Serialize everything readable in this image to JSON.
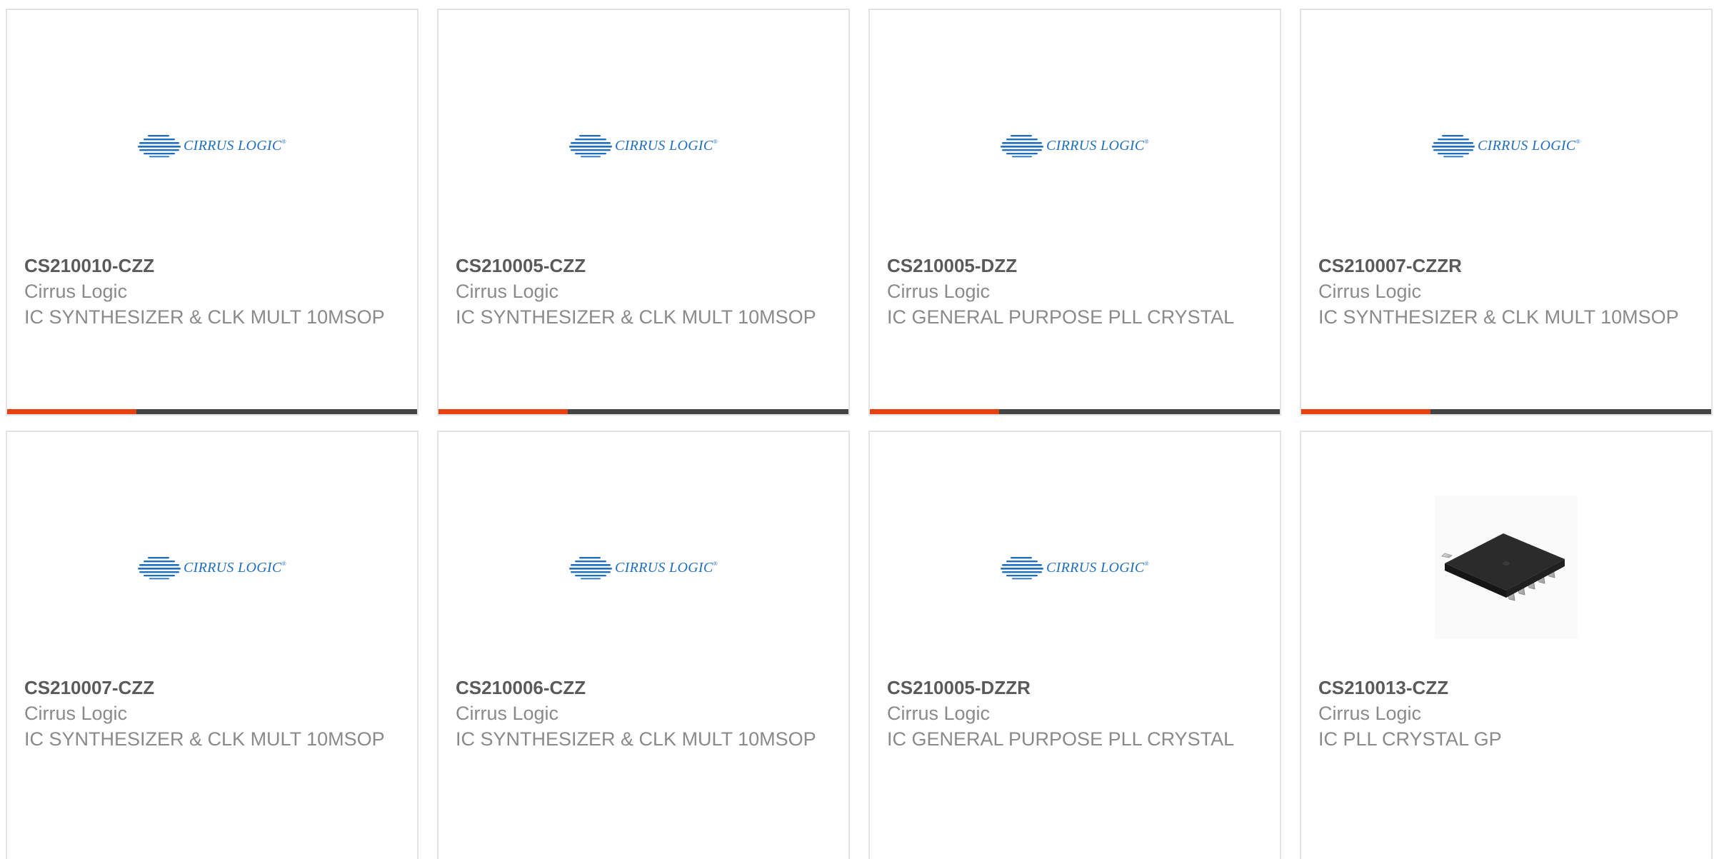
{
  "products": [
    {
      "part": "CS210010-CZZ",
      "manufacturer": "Cirrus Logic",
      "description": "IC SYNTHESIZER & CLK MULT 10MSOP",
      "image": "cirrus-logic-logo",
      "row": 1
    },
    {
      "part": "CS210005-CZZ",
      "manufacturer": "Cirrus Logic",
      "description": "IC SYNTHESIZER & CLK MULT 10MSOP",
      "image": "cirrus-logic-logo",
      "row": 1
    },
    {
      "part": "CS210005-DZZ",
      "manufacturer": "Cirrus Logic",
      "description": "IC GENERAL PURPOSE PLL CRYSTAL",
      "image": "cirrus-logic-logo",
      "row": 1
    },
    {
      "part": "CS210007-CZZR",
      "manufacturer": "Cirrus Logic",
      "description": "IC SYNTHESIZER & CLK MULT 10MSOP",
      "image": "cirrus-logic-logo",
      "row": 1
    },
    {
      "part": "CS210007-CZZ",
      "manufacturer": "Cirrus Logic",
      "description": "IC SYNTHESIZER & CLK MULT 10MSOP",
      "image": "cirrus-logic-logo",
      "row": 2
    },
    {
      "part": "CS210006-CZZ",
      "manufacturer": "Cirrus Logic",
      "description": "IC SYNTHESIZER & CLK MULT 10MSOP",
      "image": "cirrus-logic-logo",
      "row": 2
    },
    {
      "part": "CS210005-DZZR",
      "manufacturer": "Cirrus Logic",
      "description": "IC GENERAL PURPOSE PLL CRYSTAL",
      "image": "cirrus-logic-logo",
      "row": 2
    },
    {
      "part": "CS210013-CZZ",
      "manufacturer": "Cirrus Logic",
      "description": "IC PLL CRYSTAL GP",
      "image": "msop-chip-photo",
      "row": 2
    }
  ],
  "logo_text": "CIRRUS LOGIC",
  "progress_fraction": 0.315,
  "colors": {
    "accent": "#e8400f",
    "bar_track": "#444444",
    "logo_blue": "#1f6fbf",
    "part_text": "#5a5a5a",
    "body_text": "#8a8a8a",
    "card_border": "#e3e3e3"
  }
}
